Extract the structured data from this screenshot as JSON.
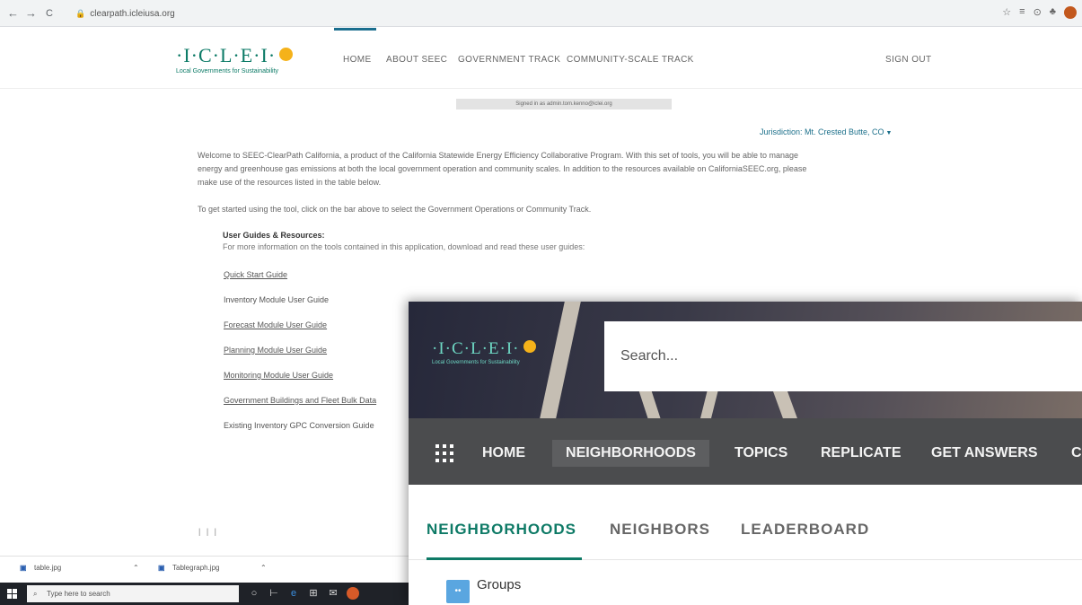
{
  "browser": {
    "back": "←",
    "forward": "→",
    "reload": "C",
    "url": "clearpath.icleiusa.org",
    "icons": [
      "☆",
      "≡",
      "⊙",
      "♣"
    ]
  },
  "site": {
    "logo_text": "·I·C·L·E·I·",
    "logo_tagline": "Local Governments for Sustainability",
    "nav": {
      "home": "HOME",
      "about": "ABOUT SEEC",
      "government": "GOVERNMENT TRACK",
      "community": "COMMUNITY-SCALE TRACK",
      "signout": "SIGN OUT"
    },
    "signed_in": "Signed in as admin.tom.kenno@iclei.org",
    "jurisdiction": "Jurisdiction: Mt. Crested Butte, CO",
    "welcome_lines": [
      "Welcome to SEEC-ClearPath California, a product of the California Statewide Energy Efficiency Collaborative Program. With this set of tools, you will be able to manage",
      "energy and greenhouse gas emissions at both the local government operation and community scales. In addition to the resources available on CaliforniaSEEC.org, please",
      "make use of the resources listed in the table below."
    ],
    "get_started": "To get started using the tool, click on the bar above to select the Government Operations or Community Track.",
    "guides_title": "User Guides & Resources:",
    "guides_sub": "For more information on the tools contained in this application, download and read these user guides:",
    "guides": [
      "Quick Start Guide",
      "Inventory Module User Guide",
      "Forecast Module User Guide",
      "Planning Module User Guide",
      "Monitoring Module User Guide",
      "Government Buildings and Fleet Bulk Data",
      "Existing Inventory GPC Conversion Guide"
    ],
    "pager": "| | |"
  },
  "downloads": {
    "item1": "table.jpg",
    "item2": "Tablegraph.jpg"
  },
  "taskbar": {
    "search_placeholder": "Type here to search"
  },
  "overlay": {
    "logo_text": "·I·C·L·E·I·",
    "logo_tagline": "Local Governments for Sustainability",
    "search_placeholder": "Search...",
    "nav": {
      "home": "HOME",
      "neighborhoods": "NEIGHBORHOODS",
      "topics": "TOPICS",
      "replicate": "REPLICATE",
      "get_answers": "GET ANSWERS",
      "cut": "C"
    },
    "tabs": {
      "neighborhoods": "NEIGHBORHOODS",
      "neighbors": "NEIGHBORS",
      "leaderboard": "LEADERBOARD"
    },
    "groups_label": "Groups",
    "accent": "#0e7a66"
  }
}
